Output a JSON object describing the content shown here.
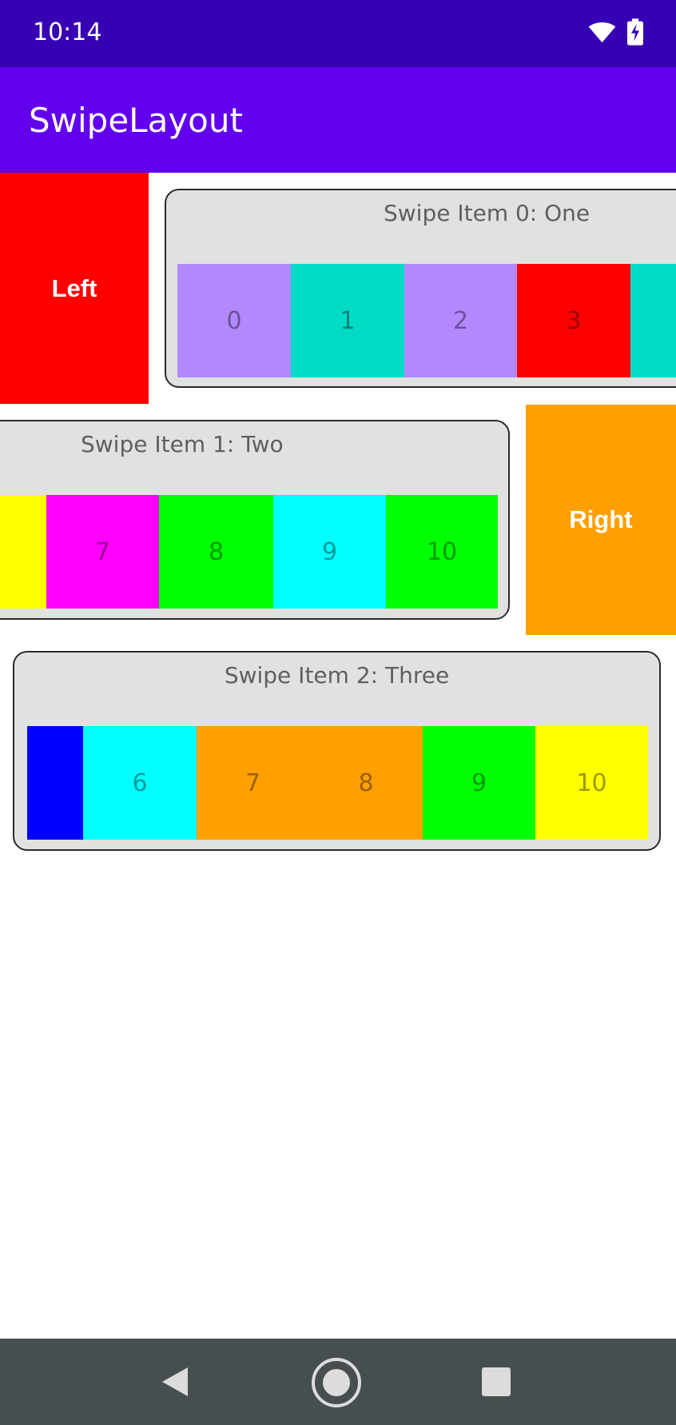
{
  "status_bar": {
    "time": "10:14",
    "icons": [
      "wifi-icon",
      "battery-charging-icon"
    ],
    "background": "#3700b3"
  },
  "app_bar": {
    "title": "SwipeLayout",
    "background": "#6200ee"
  },
  "actions": {
    "left": {
      "label": "Left",
      "color": "#ff0000"
    },
    "right": {
      "label": "Right",
      "color": "#ffa000"
    }
  },
  "items": [
    {
      "title": "Swipe Item 0: One",
      "cells": [
        {
          "label": "0",
          "color": "#b388ff"
        },
        {
          "label": "1",
          "color": "#00dbc6"
        },
        {
          "label": "2",
          "color": "#b388ff"
        },
        {
          "label": "3",
          "color": "#ff0000"
        },
        {
          "label": "",
          "color": "#00dbc6"
        }
      ]
    },
    {
      "title": "Swipe Item 1: Two",
      "cells": [
        {
          "label": "",
          "color": "#ffff00"
        },
        {
          "label": "7",
          "color": "#ff00ff"
        },
        {
          "label": "8",
          "color": "#00ff00"
        },
        {
          "label": "9",
          "color": "#00ffff"
        },
        {
          "label": "10",
          "color": "#00ff00"
        }
      ]
    },
    {
      "title": "Swipe Item 2: Three",
      "cells": [
        {
          "label": "",
          "color": "#0000ff"
        },
        {
          "label": "6",
          "color": "#00ffff"
        },
        {
          "label": "7",
          "color": "#ffa000"
        },
        {
          "label": "8",
          "color": "#ffa000"
        },
        {
          "label": "9",
          "color": "#00ff00"
        },
        {
          "label": "10",
          "color": "#ffff00"
        }
      ]
    }
  ],
  "nav_bar": {
    "buttons": [
      "back-icon",
      "home-icon",
      "recents-icon"
    ],
    "background": "#464e50",
    "icon_color": "#dcdcdc"
  }
}
